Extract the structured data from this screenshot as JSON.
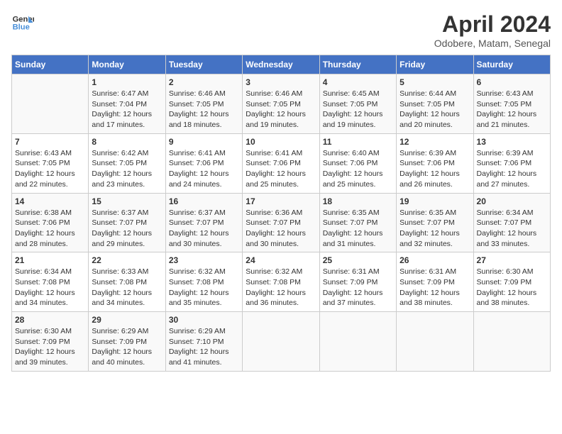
{
  "logo": {
    "line1": "General",
    "line2": "Blue"
  },
  "title": "April 2024",
  "location": "Odobere, Matam, Senegal",
  "weekdays": [
    "Sunday",
    "Monday",
    "Tuesday",
    "Wednesday",
    "Thursday",
    "Friday",
    "Saturday"
  ],
  "weeks": [
    [
      {
        "day": "",
        "sunrise": "",
        "sunset": "",
        "daylight": ""
      },
      {
        "day": "1",
        "sunrise": "Sunrise: 6:47 AM",
        "sunset": "Sunset: 7:04 PM",
        "daylight": "Daylight: 12 hours and 17 minutes."
      },
      {
        "day": "2",
        "sunrise": "Sunrise: 6:46 AM",
        "sunset": "Sunset: 7:05 PM",
        "daylight": "Daylight: 12 hours and 18 minutes."
      },
      {
        "day": "3",
        "sunrise": "Sunrise: 6:46 AM",
        "sunset": "Sunset: 7:05 PM",
        "daylight": "Daylight: 12 hours and 19 minutes."
      },
      {
        "day": "4",
        "sunrise": "Sunrise: 6:45 AM",
        "sunset": "Sunset: 7:05 PM",
        "daylight": "Daylight: 12 hours and 19 minutes."
      },
      {
        "day": "5",
        "sunrise": "Sunrise: 6:44 AM",
        "sunset": "Sunset: 7:05 PM",
        "daylight": "Daylight: 12 hours and 20 minutes."
      },
      {
        "day": "6",
        "sunrise": "Sunrise: 6:43 AM",
        "sunset": "Sunset: 7:05 PM",
        "daylight": "Daylight: 12 hours and 21 minutes."
      }
    ],
    [
      {
        "day": "7",
        "sunrise": "Sunrise: 6:43 AM",
        "sunset": "Sunset: 7:05 PM",
        "daylight": "Daylight: 12 hours and 22 minutes."
      },
      {
        "day": "8",
        "sunrise": "Sunrise: 6:42 AM",
        "sunset": "Sunset: 7:05 PM",
        "daylight": "Daylight: 12 hours and 23 minutes."
      },
      {
        "day": "9",
        "sunrise": "Sunrise: 6:41 AM",
        "sunset": "Sunset: 7:06 PM",
        "daylight": "Daylight: 12 hours and 24 minutes."
      },
      {
        "day": "10",
        "sunrise": "Sunrise: 6:41 AM",
        "sunset": "Sunset: 7:06 PM",
        "daylight": "Daylight: 12 hours and 25 minutes."
      },
      {
        "day": "11",
        "sunrise": "Sunrise: 6:40 AM",
        "sunset": "Sunset: 7:06 PM",
        "daylight": "Daylight: 12 hours and 25 minutes."
      },
      {
        "day": "12",
        "sunrise": "Sunrise: 6:39 AM",
        "sunset": "Sunset: 7:06 PM",
        "daylight": "Daylight: 12 hours and 26 minutes."
      },
      {
        "day": "13",
        "sunrise": "Sunrise: 6:39 AM",
        "sunset": "Sunset: 7:06 PM",
        "daylight": "Daylight: 12 hours and 27 minutes."
      }
    ],
    [
      {
        "day": "14",
        "sunrise": "Sunrise: 6:38 AM",
        "sunset": "Sunset: 7:06 PM",
        "daylight": "Daylight: 12 hours and 28 minutes."
      },
      {
        "day": "15",
        "sunrise": "Sunrise: 6:37 AM",
        "sunset": "Sunset: 7:07 PM",
        "daylight": "Daylight: 12 hours and 29 minutes."
      },
      {
        "day": "16",
        "sunrise": "Sunrise: 6:37 AM",
        "sunset": "Sunset: 7:07 PM",
        "daylight": "Daylight: 12 hours and 30 minutes."
      },
      {
        "day": "17",
        "sunrise": "Sunrise: 6:36 AM",
        "sunset": "Sunset: 7:07 PM",
        "daylight": "Daylight: 12 hours and 30 minutes."
      },
      {
        "day": "18",
        "sunrise": "Sunrise: 6:35 AM",
        "sunset": "Sunset: 7:07 PM",
        "daylight": "Daylight: 12 hours and 31 minutes."
      },
      {
        "day": "19",
        "sunrise": "Sunrise: 6:35 AM",
        "sunset": "Sunset: 7:07 PM",
        "daylight": "Daylight: 12 hours and 32 minutes."
      },
      {
        "day": "20",
        "sunrise": "Sunrise: 6:34 AM",
        "sunset": "Sunset: 7:07 PM",
        "daylight": "Daylight: 12 hours and 33 minutes."
      }
    ],
    [
      {
        "day": "21",
        "sunrise": "Sunrise: 6:34 AM",
        "sunset": "Sunset: 7:08 PM",
        "daylight": "Daylight: 12 hours and 34 minutes."
      },
      {
        "day": "22",
        "sunrise": "Sunrise: 6:33 AM",
        "sunset": "Sunset: 7:08 PM",
        "daylight": "Daylight: 12 hours and 34 minutes."
      },
      {
        "day": "23",
        "sunrise": "Sunrise: 6:32 AM",
        "sunset": "Sunset: 7:08 PM",
        "daylight": "Daylight: 12 hours and 35 minutes."
      },
      {
        "day": "24",
        "sunrise": "Sunrise: 6:32 AM",
        "sunset": "Sunset: 7:08 PM",
        "daylight": "Daylight: 12 hours and 36 minutes."
      },
      {
        "day": "25",
        "sunrise": "Sunrise: 6:31 AM",
        "sunset": "Sunset: 7:09 PM",
        "daylight": "Daylight: 12 hours and 37 minutes."
      },
      {
        "day": "26",
        "sunrise": "Sunrise: 6:31 AM",
        "sunset": "Sunset: 7:09 PM",
        "daylight": "Daylight: 12 hours and 38 minutes."
      },
      {
        "day": "27",
        "sunrise": "Sunrise: 6:30 AM",
        "sunset": "Sunset: 7:09 PM",
        "daylight": "Daylight: 12 hours and 38 minutes."
      }
    ],
    [
      {
        "day": "28",
        "sunrise": "Sunrise: 6:30 AM",
        "sunset": "Sunset: 7:09 PM",
        "daylight": "Daylight: 12 hours and 39 minutes."
      },
      {
        "day": "29",
        "sunrise": "Sunrise: 6:29 AM",
        "sunset": "Sunset: 7:09 PM",
        "daylight": "Daylight: 12 hours and 40 minutes."
      },
      {
        "day": "30",
        "sunrise": "Sunrise: 6:29 AM",
        "sunset": "Sunset: 7:10 PM",
        "daylight": "Daylight: 12 hours and 41 minutes."
      },
      {
        "day": "",
        "sunrise": "",
        "sunset": "",
        "daylight": ""
      },
      {
        "day": "",
        "sunrise": "",
        "sunset": "",
        "daylight": ""
      },
      {
        "day": "",
        "sunrise": "",
        "sunset": "",
        "daylight": ""
      },
      {
        "day": "",
        "sunrise": "",
        "sunset": "",
        "daylight": ""
      }
    ]
  ]
}
